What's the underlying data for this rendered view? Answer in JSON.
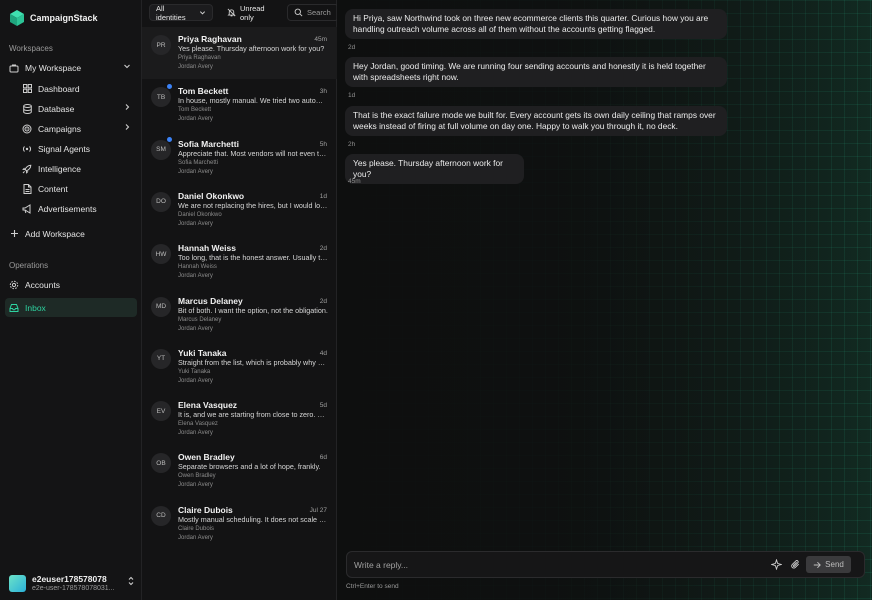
{
  "app": {
    "name": "CampaignStack"
  },
  "sidebar": {
    "workspaces_label": "Workspaces",
    "workspace": "My Workspace",
    "items": [
      {
        "label": "Dashboard",
        "icon": "grid-icon"
      },
      {
        "label": "Database",
        "icon": "database-icon"
      },
      {
        "label": "Campaigns",
        "icon": "target-icon"
      },
      {
        "label": "Signal Agents",
        "icon": "signal-icon"
      },
      {
        "label": "Intelligence",
        "icon": "rocket-icon"
      },
      {
        "label": "Content",
        "icon": "file-icon"
      },
      {
        "label": "Advertisements",
        "icon": "megaphone-icon"
      }
    ],
    "add_workspace": "Add Workspace",
    "operations_label": "Operations",
    "accounts": "Accounts",
    "inbox": "Inbox",
    "user": {
      "name": "e2euser178578078",
      "email": "e2e-user-178578078031..."
    }
  },
  "filters": {
    "identities": "All identities",
    "unread": "Unread only",
    "search_placeholder": "Search"
  },
  "conversations": [
    {
      "initials": "PR",
      "name": "Priya Raghavan",
      "time": "45m",
      "preview": "Yes please. Thursday afternoon work for you?",
      "contact": "Priya Raghavan",
      "owner": "Jordan Avery",
      "unread": false
    },
    {
      "initials": "TB",
      "name": "Tom Beckett",
      "time": "3h",
      "preview": "In house, mostly manual. We tried two automation tools and dropped both.",
      "contact": "Tom Beckett",
      "owner": "Jordan Avery",
      "unread": true
    },
    {
      "initials": "SM",
      "name": "Sofia Marchetti",
      "time": "5h",
      "preview": "Appreciate that. Most vendors will not even tell you that upfront.",
      "contact": "Sofia Marchetti",
      "owner": "Jordan Avery",
      "unread": true
    },
    {
      "initials": "DO",
      "name": "Daniel Okonkwo",
      "time": "1d",
      "preview": "We are not replacing the hires, but I would look at anything that helps them.",
      "contact": "Daniel Okonkwo",
      "owner": "Jordan Avery",
      "unread": false
    },
    {
      "initials": "HW",
      "name": "Hannah Weiss",
      "time": "2d",
      "preview": "Too long, that is the honest answer. Usually three weeks or more.",
      "contact": "Hannah Weiss",
      "owner": "Jordan Avery",
      "unread": false
    },
    {
      "initials": "MD",
      "name": "Marcus Delaney",
      "time": "2d",
      "preview": "Bit of both. I want the option, not the obligation.",
      "contact": "Marcus Delaney",
      "owner": "Jordan Avery",
      "unread": false
    },
    {
      "initials": "YT",
      "name": "Yuki Tanaka",
      "time": "4d",
      "preview": "Straight from the list, which is probably why our open rates dipped.",
      "contact": "Yuki Tanaka",
      "owner": "Jordan Avery",
      "unread": false
    },
    {
      "initials": "EV",
      "name": "Elena Vasquez",
      "time": "5d",
      "preview": "It is, and we are starting from close to zero. Send me the details.",
      "contact": "Elena Vasquez",
      "owner": "Jordan Avery",
      "unread": false
    },
    {
      "initials": "OB",
      "name": "Owen Bradley",
      "time": "6d",
      "preview": "Separate browsers and a lot of hope, frankly.",
      "contact": "Owen Bradley",
      "owner": "Jordan Avery",
      "unread": false
    },
    {
      "initials": "CD",
      "name": "Claire Dubois",
      "time": "Jul 27",
      "preview": "Mostly manual scheduling. It does not scale past a handful of accounts.",
      "contact": "Claire Dubois",
      "owner": "Jordan Avery",
      "unread": false
    }
  ],
  "thread": [
    {
      "text": "Hi Priya, saw Northwind took on three new ecommerce clients this quarter. Curious how you are handling outreach volume across all of them without the accounts getting flagged.",
      "time": "2d"
    },
    {
      "text": "Hey Jordan, good timing. We are running four sending accounts and honestly it is held together with spreadsheets right now.",
      "time": "1d"
    },
    {
      "text": "That is the exact failure mode we built for. Every account gets its own daily ceiling that ramps over weeks instead of firing at full volume on day one. Happy to walk you through it, no deck.",
      "time": "2h"
    },
    {
      "text": "Yes please. Thursday afternoon work for you?",
      "time": "45m"
    }
  ],
  "composer": {
    "placeholder": "Write a reply...",
    "send": "Send",
    "hint": "Ctrl+Enter to send"
  },
  "colors": {
    "accent": "#2ed3a0",
    "unread_dot": "#3b82f6"
  }
}
